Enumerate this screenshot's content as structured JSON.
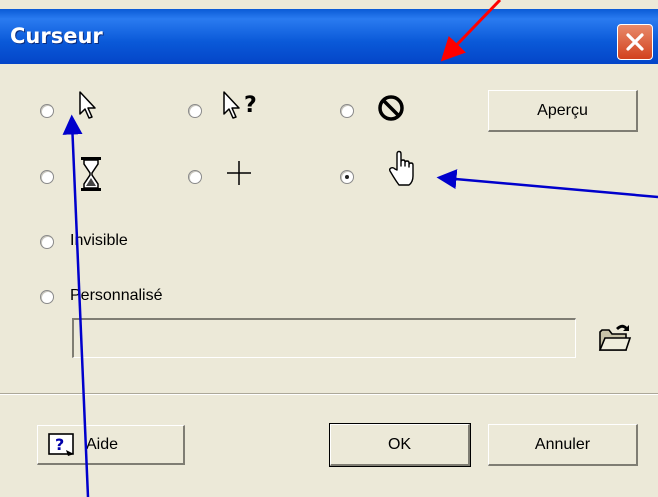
{
  "dialog": {
    "title": "Curseur",
    "close_icon": "close-x-icon"
  },
  "cursor_options": {
    "arrow": {
      "icon": "arrow-cursor-icon",
      "selected": false
    },
    "help": {
      "icon": "help-cursor-icon",
      "selected": false
    },
    "not_allowed": {
      "icon": "not-allowed-cursor-icon",
      "selected": false
    },
    "wait": {
      "icon": "hourglass-cursor-icon",
      "selected": false
    },
    "cross": {
      "icon": "crosshair-cursor-icon",
      "selected": false
    },
    "hand": {
      "icon": "hand-cursor-icon",
      "selected": true
    },
    "invisible": {
      "label": "Invisible",
      "selected": false
    },
    "custom": {
      "label": "Personnalisé",
      "selected": false,
      "path_value": ""
    }
  },
  "buttons": {
    "preview": "Aperçu",
    "help": "Aide",
    "ok": "OK",
    "cancel": "Annuler",
    "browse_icon": "open-folder-icon",
    "help_icon": "help-book-icon"
  },
  "annotations": {
    "red_arrow_color": "#ff0000",
    "blue_arrow_color": "#0000cc"
  }
}
